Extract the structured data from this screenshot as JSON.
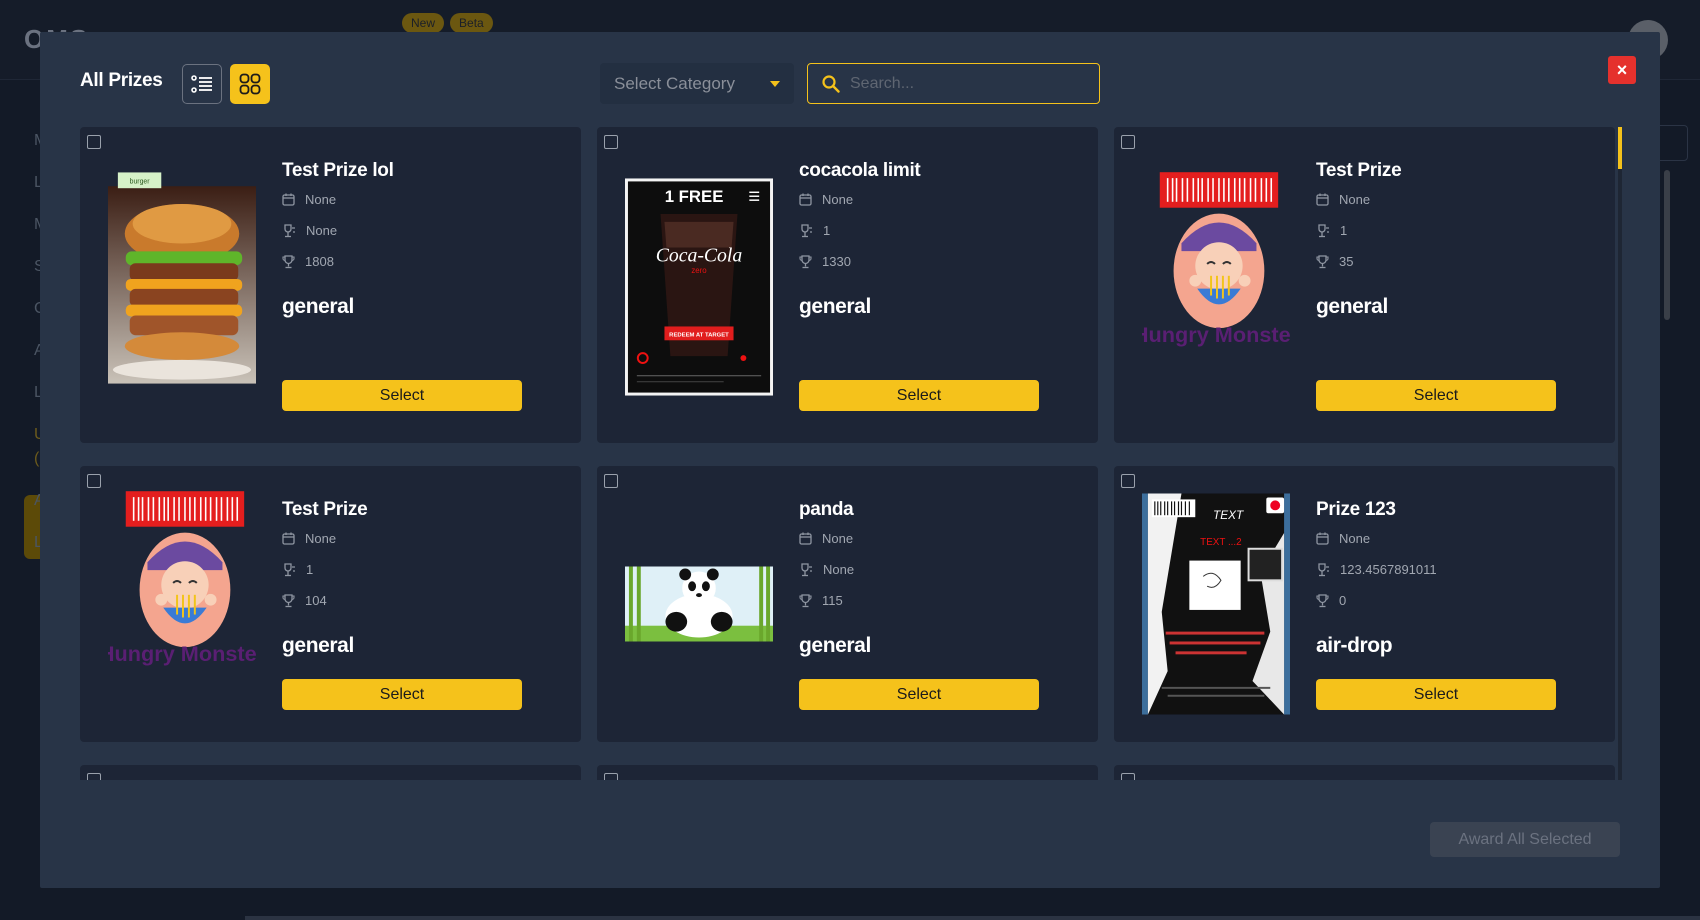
{
  "background": {
    "logo": "OMS",
    "badges": [
      "New",
      "Beta"
    ],
    "sidebar_letters": [
      "M",
      "L",
      "M",
      "S",
      "C",
      "A",
      "L",
      "U",
      "(",
      "A",
      "L"
    ]
  },
  "modal": {
    "title": "All Prizes",
    "category_select": {
      "placeholder": "Select Category"
    },
    "search": {
      "placeholder": "Search..."
    },
    "close_label": "×",
    "award_all_label": "Award All Selected",
    "select_label": "Select",
    "prizes": [
      {
        "name": "Test Prize lol",
        "date": "None",
        "quantity": "None",
        "points": "1808",
        "category": "general",
        "image": "burger-image"
      },
      {
        "name": "cocacola limit",
        "date": "None",
        "quantity": "1",
        "points": "1330",
        "category": "general",
        "image": "cocacola-image"
      },
      {
        "name": "Test Prize",
        "date": "None",
        "quantity": "1",
        "points": "35",
        "category": "general",
        "image": "hungry-monster-image"
      },
      {
        "name": "Test Prize",
        "date": "None",
        "quantity": "1",
        "points": "104",
        "category": "general",
        "image": "hungry-monster-image"
      },
      {
        "name": "panda",
        "date": "None",
        "quantity": "None",
        "points": "115",
        "category": "general",
        "image": "panda-image"
      },
      {
        "name": "Prize 123",
        "date": "None",
        "quantity": "123.4567891011",
        "points": "0",
        "category": "air-drop",
        "image": "flyer-image"
      }
    ]
  },
  "images": {
    "cocacola": {
      "top_text": "1 FREE",
      "brand": "Coca-Cola",
      "sub": "zero",
      "redeem": "REDEEM AT TARGET"
    },
    "hungry_monster": {
      "caption": "Hungry Monster"
    },
    "flyer": {
      "text1": "TEXT",
      "text2": "TEXT ...2"
    },
    "burger": {
      "tag": "burger"
    }
  },
  "colors": {
    "accent": "#f5c21b",
    "close": "#e5312d",
    "modal_bg": "#283447",
    "card_bg": "#1d2536"
  }
}
